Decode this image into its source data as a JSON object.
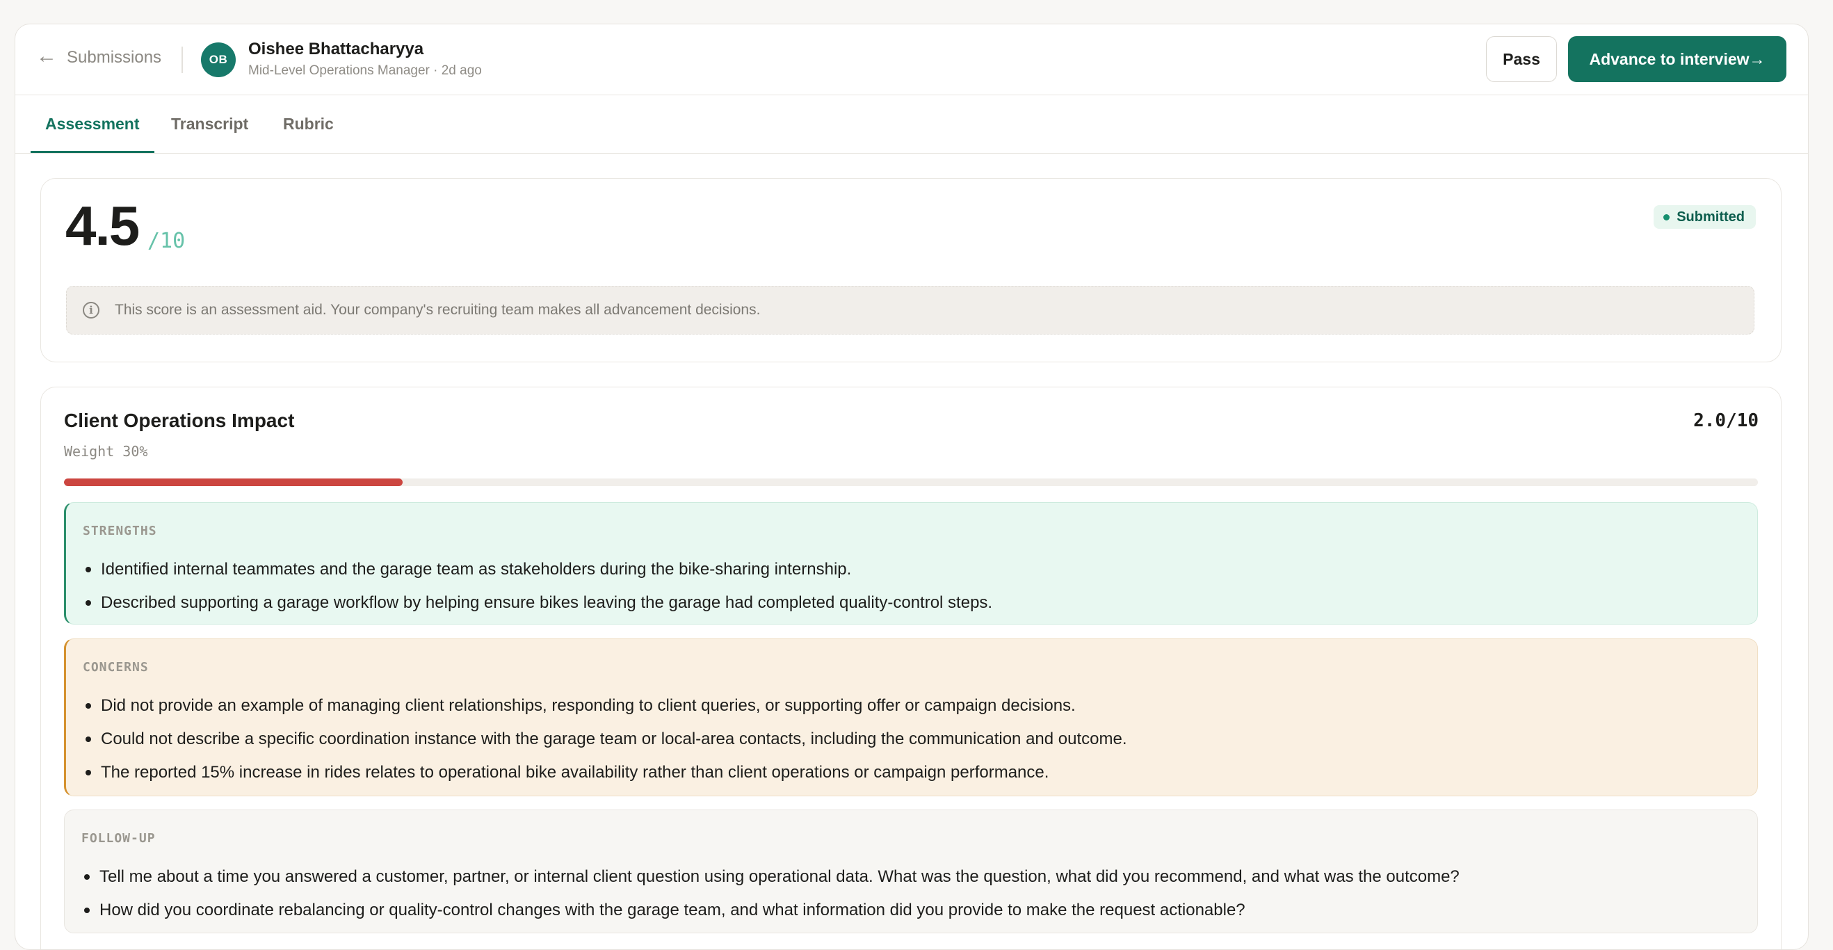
{
  "header": {
    "back_label": "Submissions",
    "back_arrow": "←",
    "avatar_initials": "OB",
    "candidate_name": "Oishee Bhattacharyya",
    "candidate_meta": "Mid-Level Operations Manager · 2d ago",
    "pass_label": "Pass",
    "advance_label": "Advance to interview→"
  },
  "tabs": [
    {
      "label": "Assessment",
      "active": true
    },
    {
      "label": "Transcript",
      "active": false
    },
    {
      "label": "Rubric",
      "active": false
    }
  ],
  "score": {
    "value": "4.5",
    "denominator": "/10",
    "status": "Submitted",
    "notice": "This score is an assessment aid. Your company's recruiting team makes all advancement decisions."
  },
  "criterion": {
    "title": "Client Operations Impact",
    "weight": "Weight 30%",
    "score_text": "2.0/10",
    "score_fraction": 0.2,
    "bar_color": "#cc4640",
    "strengths_label": "STRENGTHS",
    "strengths": [
      "Identified internal teammates and the garage team as stakeholders during the bike-sharing internship.",
      "Described supporting a garage workflow by helping ensure bikes leaving the garage had completed quality-control steps."
    ],
    "concerns_label": "CONCERNS",
    "concerns": [
      "Did not provide an example of managing client relationships, responding to client queries, or supporting offer or campaign decisions.",
      "Could not describe a specific coordination instance with the garage team or local-area contacts, including the communication and outcome.",
      "The reported 15% increase in rides relates to operational bike availability rather than client operations or campaign performance."
    ],
    "followup_label": "FOLLOW-UP",
    "followups": [
      "Tell me about a time you answered a customer, partner, or internal client question using operational data. What was the question, what did you recommend, and what was the outcome?",
      "How did you coordinate rebalancing or quality-control changes with the garage team, and what information did you provide to make the request actionable?"
    ]
  },
  "colors": {
    "accent": "#14735f",
    "submitted_badge_bg": "#e8f6ef",
    "strengths_bg": "#e8f8f1",
    "concerns_bg": "#faf0e2"
  }
}
